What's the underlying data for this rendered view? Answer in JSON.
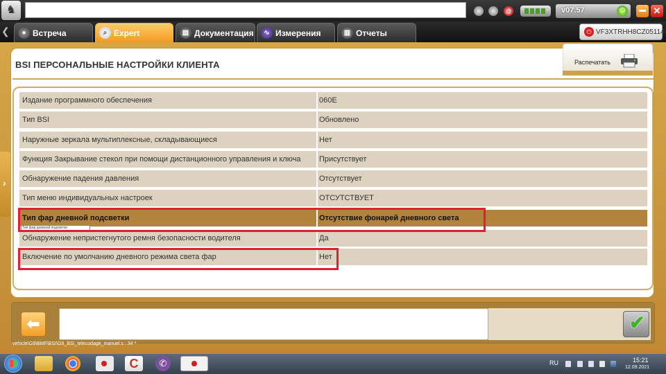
{
  "titlebar": {
    "version": "v07.57"
  },
  "tabs": [
    {
      "label": "Встреча",
      "icon": "meeting-icon"
    },
    {
      "label": "Expert",
      "icon": "magnifier-icon"
    },
    {
      "label": "Документация",
      "icon": "documentation-icon"
    },
    {
      "label": "Измерения",
      "icon": "waveform-icon"
    },
    {
      "label": "Отчеты",
      "icon": "report-icon"
    }
  ],
  "active_tab": "Expert",
  "vin": "VF3XTRHH8CZ051140",
  "page": {
    "title": "BSI  ПЕРСОНАЛЬНЫЕ НАСТРОЙКИ КЛИЕНТА",
    "print_label": "Распечатать"
  },
  "table": {
    "rows": [
      {
        "label": "Издание программного обеспечения",
        "value": "060E"
      },
      {
        "label": "Тип BSI",
        "value": "Обновлено"
      },
      {
        "label": "Наружные зеркала мультиплексные, складывающиеся",
        "value": "Нет"
      },
      {
        "label": "Функция Закрывание стекол при помощи дистанционного управления и ключа",
        "value": "Присутствует"
      },
      {
        "label": "Обнаружение падения давления",
        "value": "Отсутствует"
      },
      {
        "label": "Тип меню индивидуальных настроек",
        "value": "ОТСУТСТВУЕТ"
      },
      {
        "label": "Тип фар дневной подсветки",
        "value": "Отсутствие фонарей дневного света",
        "selected": true
      },
      {
        "label": "Обнаружение непристегнутого ремня безопасности водителя",
        "value": "Да"
      },
      {
        "label": "Включение по умолчанию дневного режима света фар",
        "value": "Нет"
      }
    ],
    "tooltip": "Тип фар дневной подсветки"
  },
  "footer": {
    "path": "vehicle\\G9\\BMF\\BSI\\G9_BSI_telecodage_manuel.s : 34 *"
  },
  "taskbar": {
    "lang": "RU",
    "time": "15:21",
    "date": "12.09.2021"
  },
  "colors": {
    "accent_orange": "#f0a030",
    "row_bg": "#dcd2bf",
    "row_selected": "#b2833c",
    "highlight_red": "#e02030",
    "frame_gold": "#c7963f"
  }
}
